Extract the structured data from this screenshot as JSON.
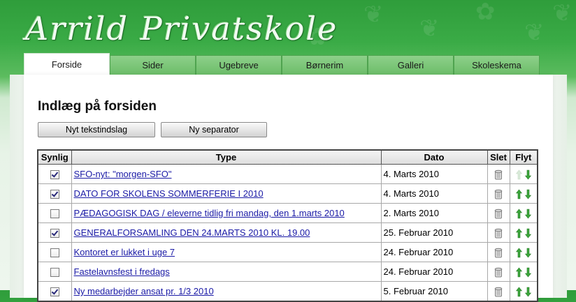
{
  "site": {
    "title": "Arrild Privatskole"
  },
  "nav": {
    "tabs": [
      {
        "label": "Forside",
        "active": true
      },
      {
        "label": "Sider",
        "active": false
      },
      {
        "label": "Ugebreve",
        "active": false
      },
      {
        "label": "Børnerim",
        "active": false
      },
      {
        "label": "Galleri",
        "active": false
      },
      {
        "label": "Skoleskema",
        "active": false
      }
    ]
  },
  "page": {
    "heading": "Indlæg på forsiden",
    "buttons": {
      "new_text": "Nyt tekstindslag",
      "new_separator": "Ny separator"
    }
  },
  "table": {
    "headers": {
      "visible": "Synlig",
      "type": "Type",
      "date": "Dato",
      "delete": "Slet",
      "move": "Flyt"
    },
    "rows": [
      {
        "visible": true,
        "title": "SFO-nyt: \"morgen-SFO\"",
        "date": "4. Marts 2010",
        "can_move_up": false,
        "can_move_down": true
      },
      {
        "visible": true,
        "title": "DATO FOR SKOLENS SOMMERFERIE I 2010",
        "date": "4. Marts 2010",
        "can_move_up": true,
        "can_move_down": true
      },
      {
        "visible": false,
        "title": "PÆDAGOGISK DAG / eleverne tidlig fri mandag, den 1.marts 2010",
        "date": "2. Marts 2010",
        "can_move_up": true,
        "can_move_down": true
      },
      {
        "visible": true,
        "title": "GENERALFORSAMLING DEN 24.MARTS 2010 KL. 19.00",
        "date": "25. Februar 2010",
        "can_move_up": true,
        "can_move_down": true
      },
      {
        "visible": false,
        "title": "Kontoret er lukket i uge 7",
        "date": "24. Februar 2010",
        "can_move_up": true,
        "can_move_down": true
      },
      {
        "visible": false,
        "title": "Fastelavnsfest i fredags",
        "date": "24. Februar 2010",
        "can_move_up": true,
        "can_move_down": true
      },
      {
        "visible": true,
        "title": "Ny medarbejder ansat pr. 1/3 2010",
        "date": "5. Februar 2010",
        "can_move_up": true,
        "can_move_down": true
      }
    ]
  },
  "colors": {
    "header_green": "#3aab46",
    "link": "#1a1aa6",
    "arrow_green": "#3aa63a"
  },
  "icons": {
    "delete": "trash-can-icon",
    "move_up": "arrow-up-icon",
    "move_down": "arrow-down-icon"
  }
}
